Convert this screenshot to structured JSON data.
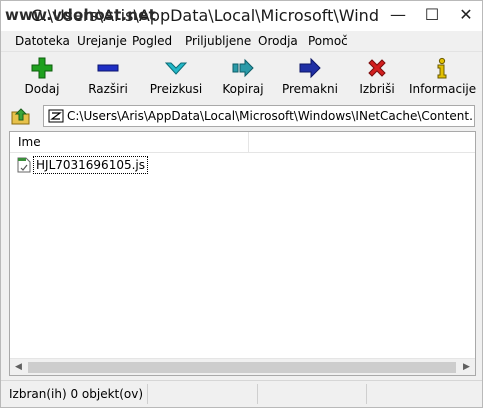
{
  "window": {
    "watermark": "www.vdohost.net",
    "title": "C:\\Users\\Aris\\AppData\\Local\\Microsoft\\Windows\\...",
    "controls": {
      "minimize": "—",
      "maximize": "☐",
      "close": "✕"
    }
  },
  "menu": [
    "Datoteka",
    "Urejanje",
    "Pogled",
    "Priljubljene",
    "Orodja",
    "Pomoč"
  ],
  "toolbar": [
    {
      "label": "Dodaj",
      "icon": "plus-icon",
      "color": "#1fa01f"
    },
    {
      "label": "Razširi",
      "icon": "minus-icon",
      "color": "#1f2fc4"
    },
    {
      "label": "Preizkusi",
      "icon": "check-arrow-icon",
      "color": "#23b8c8"
    },
    {
      "label": "Kopiraj",
      "icon": "copy-arrow-icon",
      "color": "#2a9aa8"
    },
    {
      "label": "Premakni",
      "icon": "move-arrow-icon",
      "color": "#1f2fa4"
    },
    {
      "label": "Izbriši",
      "icon": "delete-x-icon",
      "color": "#d21f1f"
    },
    {
      "label": "Informacije",
      "icon": "info-icon",
      "color": "#e2c000"
    }
  ],
  "address": {
    "path": "C:\\Users\\Aris\\AppData\\Local\\Microsoft\\Windows\\INetCache\\Content.Outlook"
  },
  "list": {
    "column": "Ime",
    "items": [
      {
        "name": "HJL7031696105.js"
      }
    ]
  },
  "status": {
    "text": "Izbran(ih) 0 objekt(ov)"
  }
}
